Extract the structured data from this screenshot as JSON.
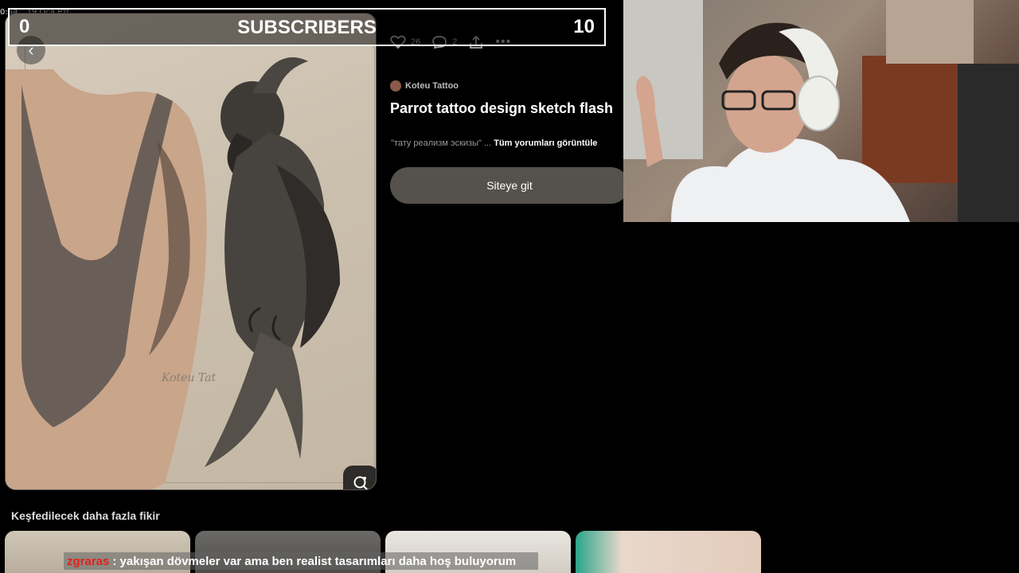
{
  "status_bar": {
    "time": "0:54",
    "date": "19 Oca Pzt"
  },
  "overlay": {
    "left_count": "0",
    "title": "SUBSCRIBERS",
    "right_count": "10"
  },
  "pin": {
    "actions": {
      "likes": "26",
      "comments": "2"
    },
    "creator": "Koteu Tattoo",
    "title": "Parrot tattoo design sketch flash",
    "comment_preview": "\"тату реализм эскизы\" ...",
    "comments_link": "Tüm yorumları görüntüle",
    "site_button": "Siteye git",
    "image_signature": "Koteu Tat"
  },
  "more_ideas": {
    "heading": "Keşfedilecek daha fazla fikir"
  },
  "chat": {
    "username": "zgraras",
    "message": ": yakışan dövmeler var ama ben realist tasarımları daha hoş buluyorum"
  },
  "colors": {
    "background": "#000000",
    "button": "#55514b",
    "chat_user": "#e0231c"
  },
  "icons": [
    "chevron-left-icon",
    "heart-icon",
    "comment-icon",
    "share-icon",
    "more-icon",
    "visual-search-icon"
  ]
}
